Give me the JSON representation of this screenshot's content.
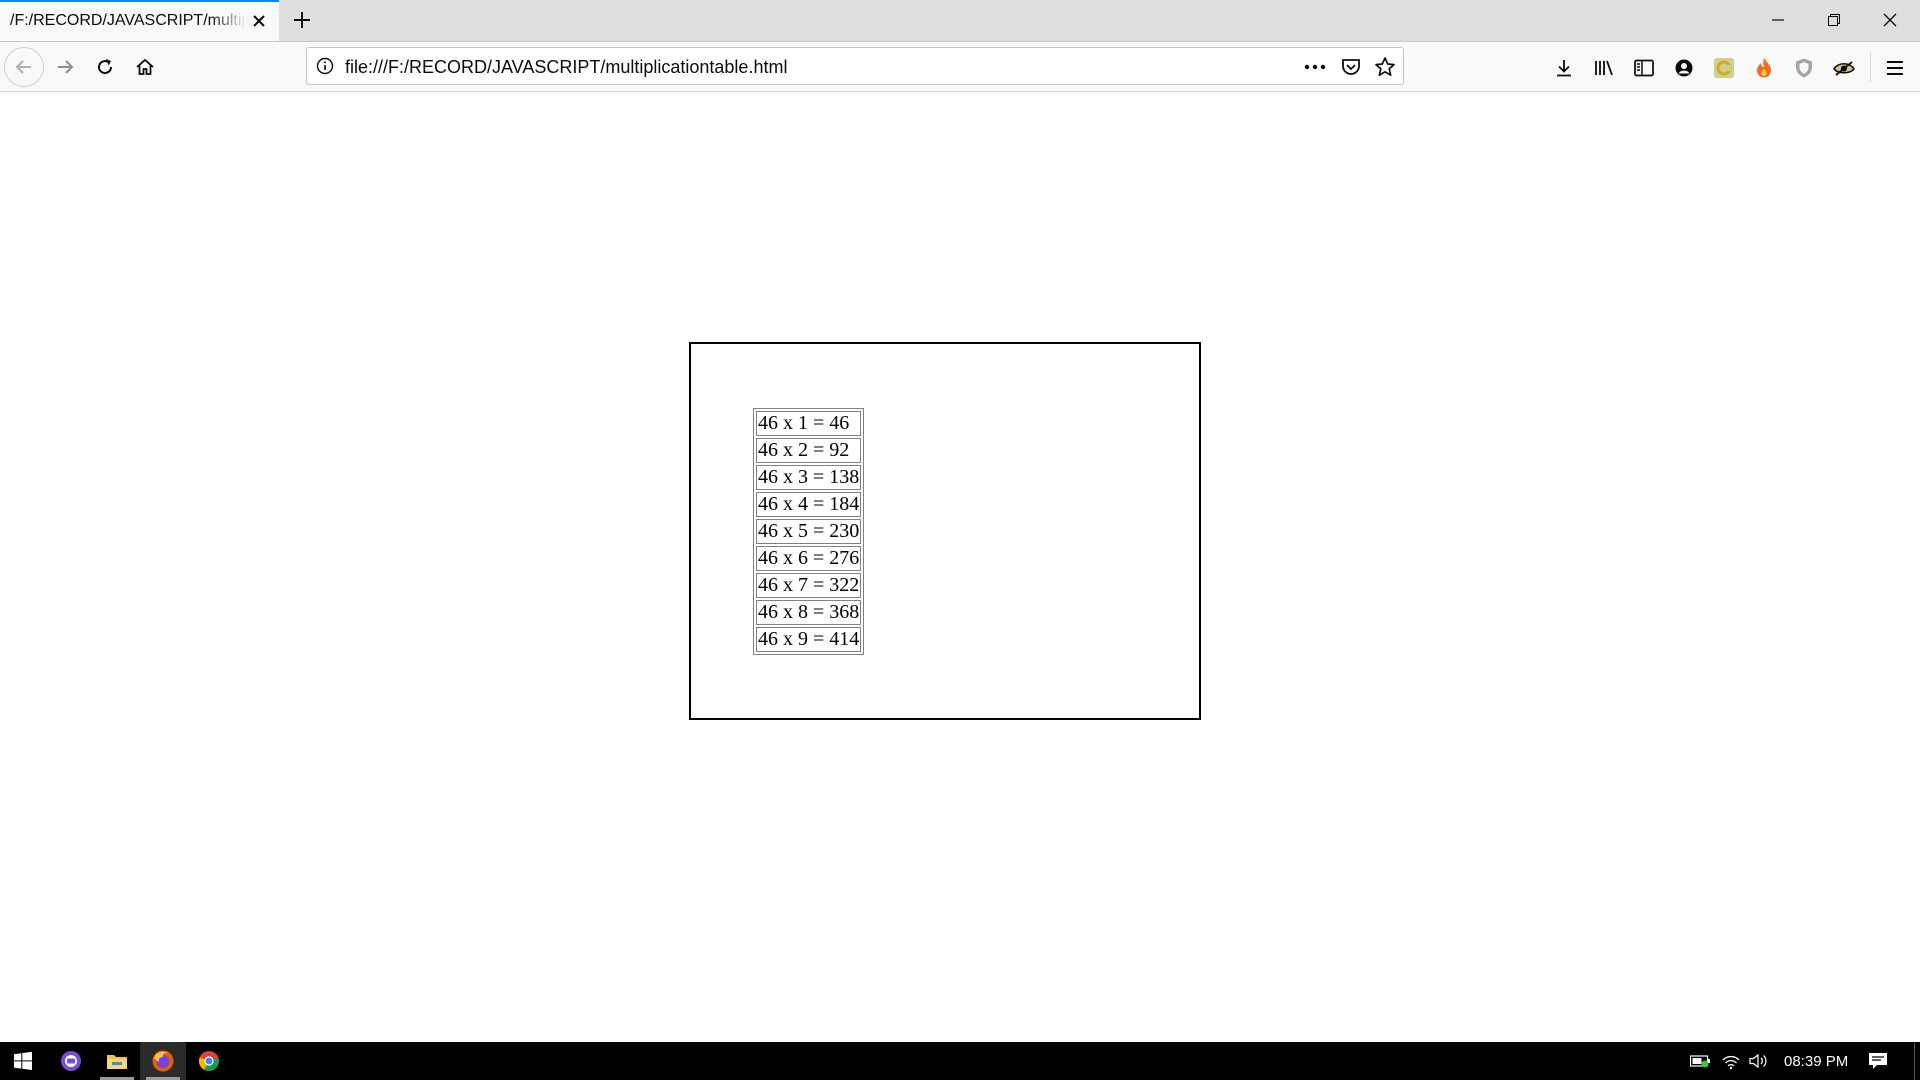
{
  "browser": {
    "tab_title": "/F:/RECORD/JAVASCRIPT/multiplicationtable.html",
    "url": "file:///F:/RECORD/JAVASCRIPT/multiplicationtable.html"
  },
  "table": {
    "rows": [
      "46 x 1 = 46",
      "46 x 2 = 92",
      "46 x 3 = 138",
      "46 x 4 = 184",
      "46 x 5 = 230",
      "46 x 6 = 276",
      "46 x 7 = 322",
      "46 x 8 = 368",
      "46 x 9 = 414"
    ]
  },
  "taskbar": {
    "clock": "08:39 PM"
  },
  "colors": {
    "tab_accent": "#0a84ff",
    "chrome_bg": "#dedede",
    "toolbar_bg": "#f9f9fa",
    "taskbar_bg": "#000000"
  }
}
